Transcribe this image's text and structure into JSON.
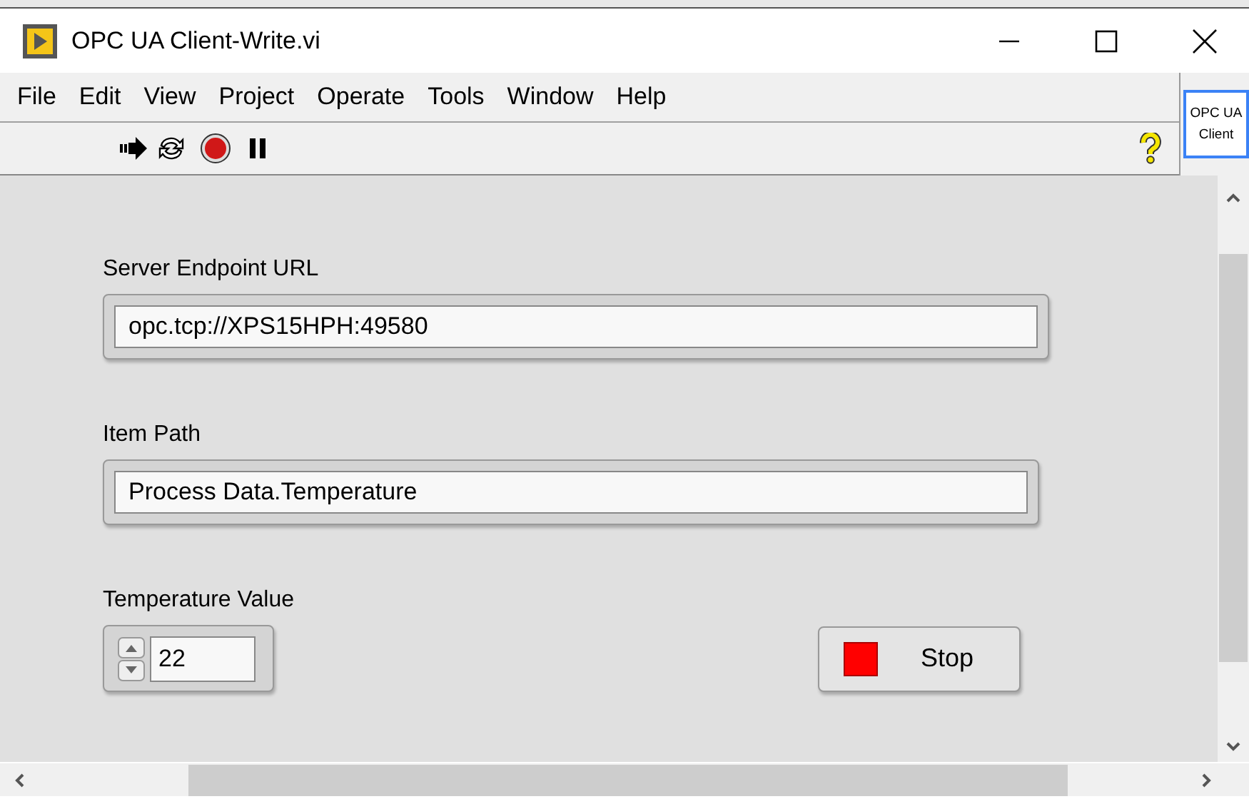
{
  "window": {
    "title": "OPC UA Client-Write.vi"
  },
  "menu": [
    "File",
    "Edit",
    "View",
    "Project",
    "Operate",
    "Tools",
    "Window",
    "Help"
  ],
  "connector_pane": {
    "line_1": "OPC UA",
    "line_2": "Client"
  },
  "controls": [
    {
      "kind": "string",
      "label": "Server Endpoint URL",
      "value": "opc.tcp://XPS15HPH:49580"
    },
    {
      "kind": "string",
      "label": "Item Path",
      "value": "Process Data.Temperature"
    },
    {
      "kind": "numeric",
      "label": "Temperature Value",
      "value": "22"
    }
  ],
  "stop_button": {
    "label": "Stop",
    "pressed": false
  }
}
